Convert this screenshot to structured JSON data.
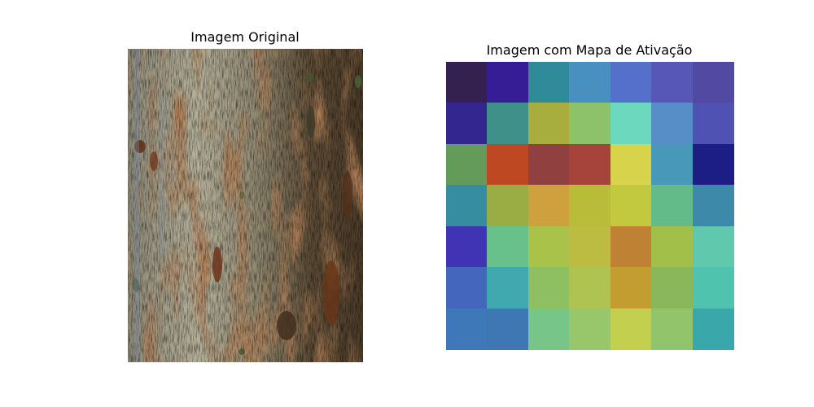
{
  "figure": {
    "left_title": "Imagem Original",
    "right_title": "Imagem com Mapa de Ativação"
  },
  "heatmap": {
    "rows": 7,
    "cols": 7,
    "colors": [
      [
        "#35214f",
        "#361c95",
        "#2f8a9a",
        "#4790c0",
        "#5470cb",
        "#5757b8",
        "#5149a2"
      ],
      [
        "#34268f",
        "#3e9088",
        "#a8ae3d",
        "#8ec26a",
        "#6cd9bf",
        "#578ec8",
        "#5052b3"
      ],
      [
        "#649a5a",
        "#be4822",
        "#8f403f",
        "#a6433b",
        "#d7d44c",
        "#4898b9",
        "#1d1d86"
      ],
      [
        "#368d9f",
        "#99ad44",
        "#cfa13e",
        "#b8bc38",
        "#c2c93e",
        "#64bb8a",
        "#3d89aa"
      ],
      [
        "#4134b4",
        "#68c18a",
        "#a8c24a",
        "#bdbc42",
        "#bf8235",
        "#a2bf4a",
        "#5fc8ad"
      ],
      [
        "#4466bd",
        "#3fa9af",
        "#8ec062",
        "#afc450",
        "#c49d30",
        "#89b759",
        "#4fc3ad"
      ],
      [
        "#3f78b8",
        "#3e77b4",
        "#78c58a",
        "#97c76a",
        "#c3cf4e",
        "#92c56b",
        "#3aa7ab"
      ]
    ]
  }
}
